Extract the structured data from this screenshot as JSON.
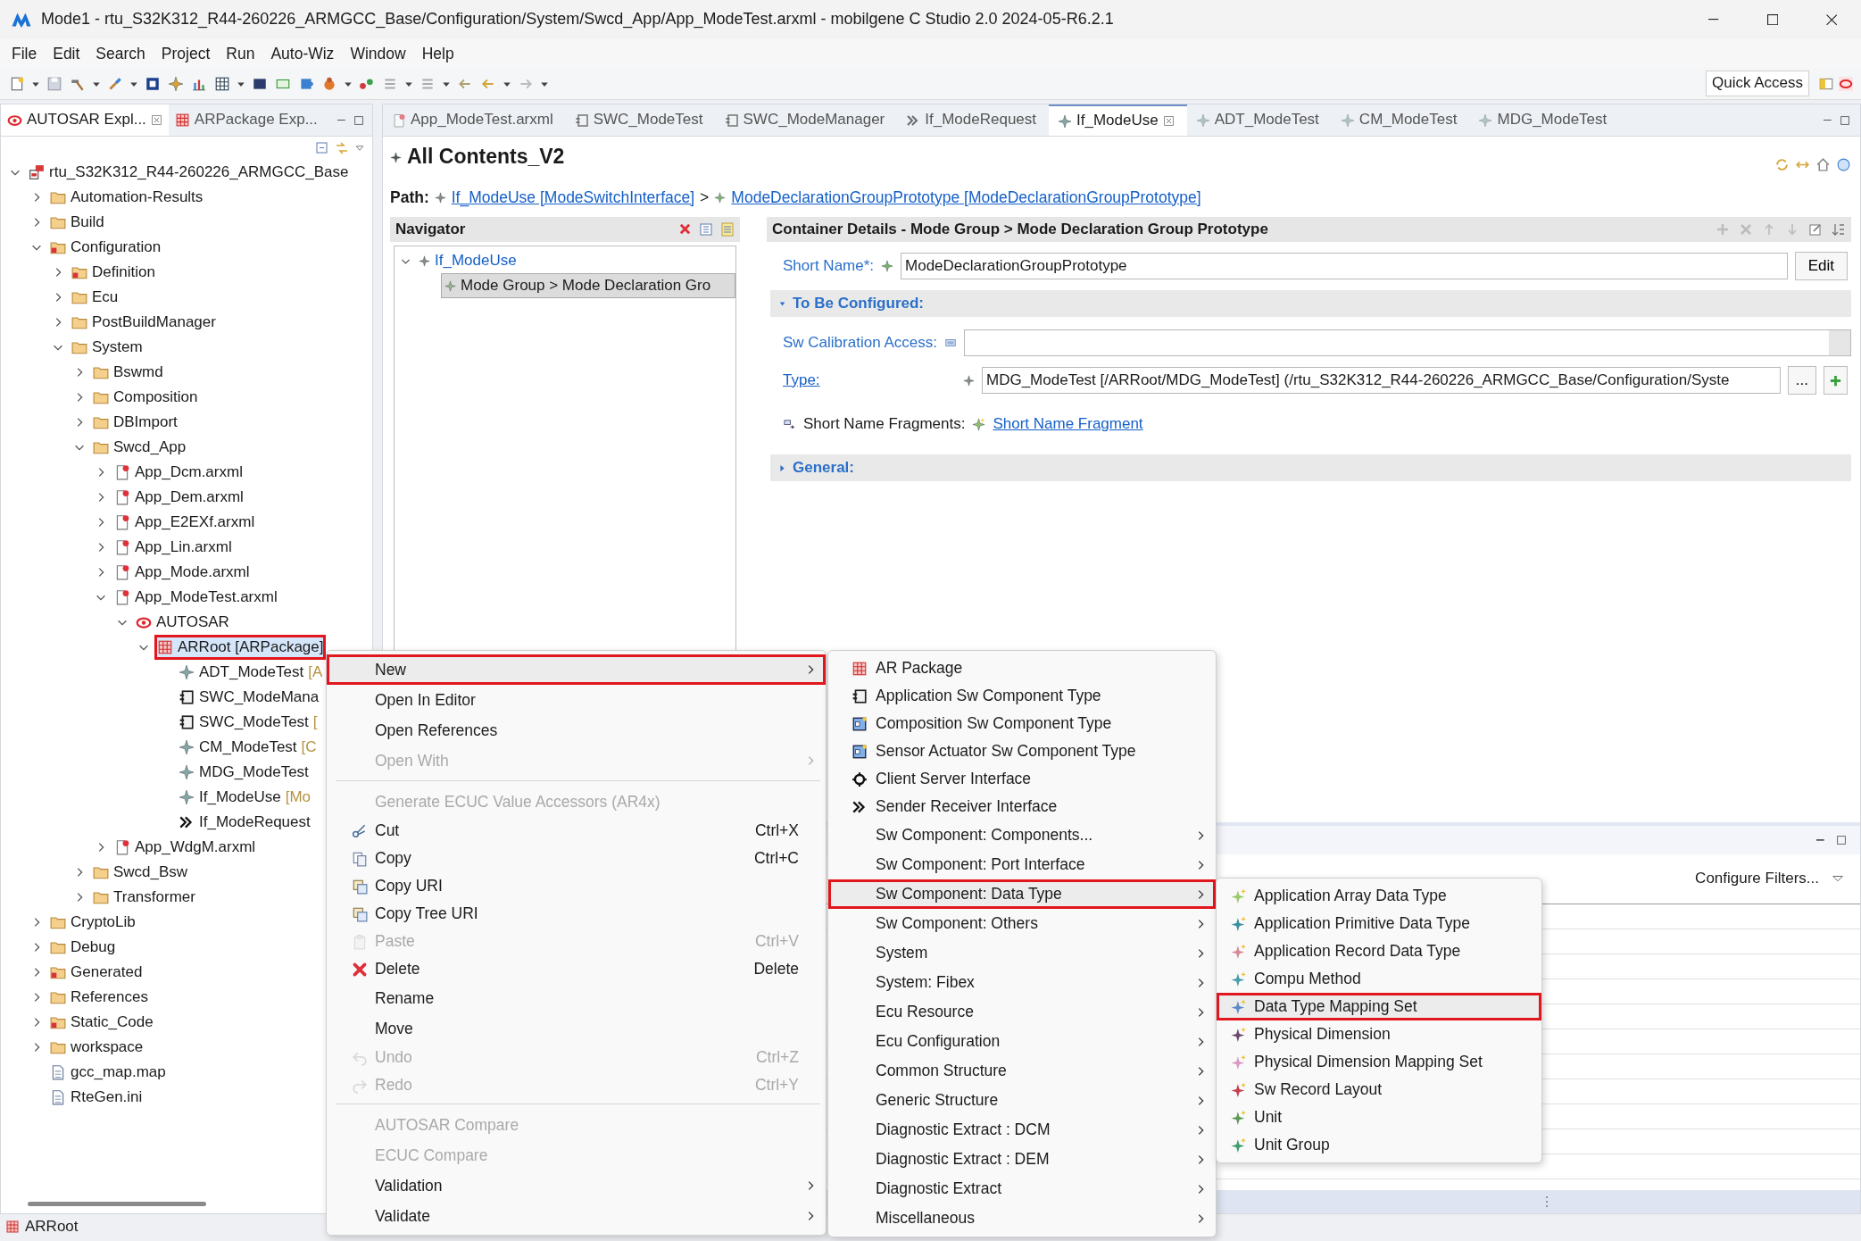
{
  "window": {
    "title": "Mode1 - rtu_S32K312_R44-260226_ARMGCC_Base/Configuration/System/Swcd_App/App_ModeTest.arxml - mobilgene C Studio 2.0 2024-05-R6.2.1"
  },
  "menu_bar": [
    "File",
    "Edit",
    "Search",
    "Project",
    "Run",
    "Auto-Wiz",
    "Window",
    "Help"
  ],
  "quick_access": "Quick Access",
  "explorer": {
    "tabs": [
      {
        "label": "AUTOSAR Expl...",
        "selected": true,
        "kind": "autosar"
      },
      {
        "label": "ARPackage Exp...",
        "selected": false,
        "kind": "package"
      }
    ],
    "tree": [
      {
        "label": "rtu_S32K312_R44-260226_ARMGCC_Base",
        "kind": "project",
        "expanded": true,
        "selected": false,
        "highlighted": false,
        "children": [
          {
            "label": "Automation-Results",
            "kind": "folder",
            "expanded": false,
            "selected": false,
            "highlighted": false
          },
          {
            "label": "Build",
            "kind": "folder",
            "expanded": false,
            "selected": false,
            "highlighted": false
          },
          {
            "label": "Configuration",
            "kind": "folderx",
            "expanded": true,
            "selected": false,
            "highlighted": false,
            "children": [
              {
                "label": "Definition",
                "kind": "folderx",
                "expanded": false,
                "selected": false,
                "highlighted": false
              },
              {
                "label": "Ecu",
                "kind": "folder",
                "expanded": false,
                "selected": false,
                "highlighted": false
              },
              {
                "label": "PostBuildManager",
                "kind": "folder",
                "expanded": false,
                "selected": false,
                "highlighted": false
              },
              {
                "label": "System",
                "kind": "folder",
                "expanded": true,
                "selected": false,
                "highlighted": false,
                "children": [
                  {
                    "label": "Bswmd",
                    "kind": "folder",
                    "expanded": false,
                    "selected": false,
                    "highlighted": false
                  },
                  {
                    "label": "Composition",
                    "kind": "folder",
                    "expanded": false,
                    "selected": false,
                    "highlighted": false
                  },
                  {
                    "label": "DBImport",
                    "kind": "folder",
                    "expanded": false,
                    "selected": false,
                    "highlighted": false
                  },
                  {
                    "label": "Swcd_App",
                    "kind": "folder",
                    "expanded": true,
                    "selected": false,
                    "highlighted": false,
                    "children": [
                      {
                        "label": "App_Dcm.arxml",
                        "kind": "file",
                        "expanded": false,
                        "selected": false,
                        "highlighted": false
                      },
                      {
                        "label": "App_Dem.arxml",
                        "kind": "file",
                        "expanded": false,
                        "selected": false,
                        "highlighted": false
                      },
                      {
                        "label": "App_E2EXf.arxml",
                        "kind": "file",
                        "expanded": false,
                        "selected": false,
                        "highlighted": false
                      },
                      {
                        "label": "App_Lin.arxml",
                        "kind": "file",
                        "expanded": false,
                        "selected": false,
                        "highlighted": false
                      },
                      {
                        "label": "App_Mode.arxml",
                        "kind": "file",
                        "expanded": false,
                        "selected": false,
                        "highlighted": false
                      },
                      {
                        "label": "App_ModeTest.arxml",
                        "kind": "file",
                        "expanded": true,
                        "selected": false,
                        "highlighted": false,
                        "children": [
                          {
                            "label": "AUTOSAR",
                            "kind": "autosar",
                            "expanded": true,
                            "selected": false,
                            "highlighted": false,
                            "children": [
                              {
                                "label": "ARRoot [ARPackage]",
                                "kind": "package",
                                "expanded": true,
                                "selected": true,
                                "highlighted": true,
                                "children": [
                                  {
                                    "label": "ADT_ModeTest",
                                    "suffix": "[A",
                                    "kind": "element",
                                    "selected": false,
                                    "highlighted": false
                                  },
                                  {
                                    "label": "SWC_ModeMana",
                                    "kind": "component",
                                    "selected": false,
                                    "highlighted": false
                                  },
                                  {
                                    "label": "SWC_ModeTest",
                                    "suffix": "[",
                                    "kind": "component",
                                    "selected": false,
                                    "highlighted": false
                                  },
                                  {
                                    "label": "CM_ModeTest",
                                    "suffix": "[C",
                                    "kind": "element",
                                    "selected": false,
                                    "highlighted": false
                                  },
                                  {
                                    "label": "MDG_ModeTest",
                                    "kind": "element",
                                    "selected": false,
                                    "highlighted": false
                                  },
                                  {
                                    "label": "If_ModeUse",
                                    "suffix": "[Mo",
                                    "kind": "element",
                                    "selected": false,
                                    "highlighted": false
                                  },
                                  {
                                    "label": "If_ModeRequest",
                                    "kind": "interface",
                                    "selected": false,
                                    "highlighted": false
                                  }
                                ]
                              }
                            ]
                          }
                        ]
                      },
                      {
                        "label": "App_WdgM.arxml",
                        "kind": "file",
                        "expanded": false,
                        "selected": false,
                        "highlighted": false
                      }
                    ]
                  },
                  {
                    "label": "Swcd_Bsw",
                    "kind": "folder",
                    "expanded": false,
                    "selected": false,
                    "highlighted": false
                  },
                  {
                    "label": "Transformer",
                    "kind": "folder",
                    "expanded": false,
                    "selected": false,
                    "highlighted": false
                  }
                ]
              }
            ]
          },
          {
            "label": "CryptoLib",
            "kind": "folder",
            "expanded": false,
            "selected": false,
            "highlighted": false
          },
          {
            "label": "Debug",
            "kind": "folder",
            "expanded": false,
            "selected": false,
            "highlighted": false
          },
          {
            "label": "Generated",
            "kind": "folderx",
            "expanded": false,
            "selected": false,
            "highlighted": false
          },
          {
            "label": "References",
            "kind": "folder",
            "expanded": false,
            "selected": false,
            "highlighted": false
          },
          {
            "label": "Static_Code",
            "kind": "folderx",
            "expanded": false,
            "selected": false,
            "highlighted": false
          },
          {
            "label": "workspace",
            "kind": "folder",
            "expanded": false,
            "selected": false,
            "highlighted": false
          },
          {
            "label": "gcc_map.map",
            "kind": "plain",
            "selected": false,
            "highlighted": false
          },
          {
            "label": "RteGen.ini",
            "kind": "plain",
            "selected": false,
            "highlighted": false
          }
        ]
      }
    ]
  },
  "editor_tabs": [
    {
      "label": "App_ModeTest.arxml",
      "selected": false,
      "kind": "file"
    },
    {
      "label": "SWC_ModeTest",
      "selected": false,
      "kind": "component"
    },
    {
      "label": "SWC_ModeManager",
      "selected": false,
      "kind": "component"
    },
    {
      "label": "If_ModeRequest",
      "selected": false,
      "kind": "interface"
    },
    {
      "label": "If_ModeUse",
      "selected": true,
      "kind": "element"
    },
    {
      "label": "ADT_ModeTest",
      "selected": false,
      "kind": "element"
    },
    {
      "label": "CM_ModeTest",
      "selected": false,
      "kind": "element"
    },
    {
      "label": "MDG_ModeTest",
      "selected": false,
      "kind": "element"
    }
  ],
  "editor": {
    "title": "All Contents_V2",
    "path_label": "Path:",
    "path": [
      "If_ModeUse [ModeSwitchInterface]",
      "ModeDeclarationGroupPrototype [ModeDeclarationGroupPrototype]"
    ],
    "path_separator": ">"
  },
  "navigator": {
    "title": "Navigator",
    "tree": [
      {
        "label": "If_ModeUse",
        "expanded": true,
        "selected": false,
        "children": [
          {
            "label": "Mode Group > Mode Declaration Gro",
            "selected": true
          }
        ]
      }
    ]
  },
  "details": {
    "title": "Container Details - Mode Group > Mode Declaration Group Prototype",
    "short_name_label": "Short Name*:",
    "short_name": "ModeDeclarationGroupPrototype",
    "edit_button": "Edit",
    "sections": [
      {
        "title": "To Be Configured:",
        "expanded": true,
        "fields": [
          {
            "kind": "combo",
            "label": "Sw Calibration Access:"
          },
          {
            "kind": "reference",
            "label": "Type:",
            "value": "MDG_ModeTest [/ARRoot/MDG_ModeTest] (/rtu_S32K312_R44-260226_ARMGCC_Base/Configuration/Syste",
            "browse_button": "..."
          },
          {
            "kind": "fragments",
            "label": "Short Name Fragments:",
            "link": "Short Name Fragment"
          }
        ]
      },
      {
        "title": "General:",
        "expanded": false
      }
    ]
  },
  "bottom_panel": {
    "filter_button": "Configure Filters..."
  },
  "status_bar": {
    "text": "ARRoot"
  },
  "context_menu": [
    {
      "kind": "text",
      "label": "New",
      "submenu": true,
      "disabled": false,
      "highlighted": true
    },
    {
      "kind": "text",
      "label": "Open In Editor",
      "submenu": false,
      "disabled": false,
      "highlighted": false
    },
    {
      "kind": "text",
      "label": "Open References",
      "submenu": false,
      "disabled": false,
      "highlighted": false
    },
    {
      "kind": "text",
      "label": "Open With",
      "submenu": true,
      "disabled": true,
      "highlighted": false
    },
    {
      "kind": "separator"
    },
    {
      "kind": "text",
      "label": "Generate ECUC Value Accessors (AR4x)",
      "submenu": false,
      "disabled": true,
      "highlighted": false
    },
    {
      "kind": "cut",
      "label": "Cut",
      "shortcut": "Ctrl+X",
      "submenu": false,
      "disabled": false,
      "highlighted": false
    },
    {
      "kind": "copy",
      "label": "Copy",
      "shortcut": "Ctrl+C",
      "submenu": false,
      "disabled": false,
      "highlighted": false
    },
    {
      "kind": "uri",
      "label": "Copy URI",
      "submenu": false,
      "disabled": false,
      "highlighted": false
    },
    {
      "kind": "uri",
      "label": "Copy Tree URI",
      "submenu": false,
      "disabled": false,
      "highlighted": false
    },
    {
      "kind": "paste",
      "label": "Paste",
      "shortcut": "Ctrl+V",
      "submenu": false,
      "disabled": true,
      "highlighted": false
    },
    {
      "kind": "delete",
      "label": "Delete",
      "shortcut": "Delete",
      "submenu": false,
      "disabled": false,
      "highlighted": false
    },
    {
      "kind": "text",
      "label": "Rename",
      "submenu": false,
      "disabled": false,
      "highlighted": false
    },
    {
      "kind": "text",
      "label": "Move",
      "submenu": false,
      "disabled": false,
      "highlighted": false
    },
    {
      "kind": "undo",
      "label": "Undo",
      "shortcut": "Ctrl+Z",
      "submenu": false,
      "disabled": true,
      "highlighted": false
    },
    {
      "kind": "redo",
      "label": "Redo",
      "shortcut": "Ctrl+Y",
      "submenu": false,
      "disabled": true,
      "highlighted": false
    },
    {
      "kind": "separator"
    },
    {
      "kind": "text",
      "label": "AUTOSAR Compare",
      "submenu": false,
      "disabled": true,
      "highlighted": false
    },
    {
      "kind": "text",
      "label": "ECUC Compare",
      "submenu": false,
      "disabled": true,
      "highlighted": false
    },
    {
      "kind": "text",
      "label": "Validation",
      "submenu": true,
      "disabled": false,
      "highlighted": false
    },
    {
      "kind": "text",
      "label": "Validate",
      "submenu": true,
      "disabled": false,
      "highlighted": false
    }
  ],
  "new_submenu": [
    {
      "kind": "package",
      "label": "AR Package",
      "submenu": false,
      "disabled": false,
      "highlighted": false
    },
    {
      "kind": "component",
      "label": "Application Sw Component Type",
      "submenu": false,
      "disabled": false,
      "highlighted": false
    },
    {
      "kind": "composition",
      "label": "Composition Sw Component Type",
      "submenu": false,
      "disabled": false,
      "highlighted": false
    },
    {
      "kind": "composition",
      "label": "Sensor Actuator Sw Component Type",
      "submenu": false,
      "disabled": false,
      "highlighted": false
    },
    {
      "kind": "client-server",
      "label": "Client Server Interface",
      "submenu": false,
      "disabled": false,
      "highlighted": false
    },
    {
      "kind": "interface",
      "label": "Sender Receiver Interface",
      "submenu": false,
      "disabled": false,
      "highlighted": false
    },
    {
      "kind": "text",
      "label": "Sw Component: Components...",
      "submenu": true,
      "disabled": false,
      "highlighted": false
    },
    {
      "kind": "text",
      "label": "Sw Component: Port Interface",
      "submenu": true,
      "disabled": false,
      "highlighted": false
    },
    {
      "kind": "text",
      "label": "Sw Component: Data Type",
      "submenu": true,
      "disabled": false,
      "highlighted": true
    },
    {
      "kind": "text",
      "label": "Sw Component: Others",
      "submenu": true,
      "disabled": false,
      "highlighted": false
    },
    {
      "kind": "text",
      "label": "System",
      "submenu": true,
      "disabled": false,
      "highlighted": false
    },
    {
      "kind": "text",
      "label": "System: Fibex",
      "submenu": true,
      "disabled": false,
      "highlighted": false
    },
    {
      "kind": "text",
      "label": "Ecu Resource",
      "submenu": true,
      "disabled": false,
      "highlighted": false
    },
    {
      "kind": "text",
      "label": "Ecu Configuration",
      "submenu": true,
      "disabled": false,
      "highlighted": false
    },
    {
      "kind": "text",
      "label": "Common Structure",
      "submenu": true,
      "disabled": false,
      "highlighted": false
    },
    {
      "kind": "text",
      "label": "Generic Structure",
      "submenu": true,
      "disabled": false,
      "highlighted": false
    },
    {
      "kind": "text",
      "label": "Diagnostic Extract : DCM",
      "submenu": true,
      "disabled": false,
      "highlighted": false
    },
    {
      "kind": "text",
      "label": "Diagnostic Extract : DEM",
      "submenu": true,
      "disabled": false,
      "highlighted": false
    },
    {
      "kind": "text",
      "label": "Diagnostic Extract",
      "submenu": true,
      "disabled": false,
      "highlighted": false
    },
    {
      "kind": "text",
      "label": "Miscellaneous",
      "submenu": true,
      "disabled": false,
      "highlighted": false
    }
  ],
  "data_type_submenu": [
    {
      "kind": "sparkle",
      "label": "Application Array Data Type",
      "color": "#9cc96a",
      "submenu": false,
      "disabled": false,
      "highlighted": false
    },
    {
      "kind": "sparkle",
      "label": "Application Primitive Data Type",
      "color": "#3b8f9e",
      "submenu": false,
      "disabled": false,
      "highlighted": false
    },
    {
      "kind": "sparkle",
      "label": "Application Record Data Type",
      "color": "#d68a96",
      "submenu": false,
      "disabled": false,
      "highlighted": false
    },
    {
      "kind": "sparkle",
      "label": "Compu Method",
      "color": "#4a9cae",
      "submenu": false,
      "disabled": false,
      "highlighted": false
    },
    {
      "kind": "sparkle",
      "label": "Data Type Mapping Set",
      "color": "#5b8bc9",
      "submenu": false,
      "disabled": false,
      "highlighted": true
    },
    {
      "kind": "sparkle",
      "label": "Physical Dimension",
      "color": "#6b4a6b",
      "submenu": false,
      "disabled": false,
      "highlighted": false
    },
    {
      "kind": "sparkle",
      "label": "Physical Dimension Mapping Set",
      "color": "#d99ac4",
      "submenu": false,
      "disabled": false,
      "highlighted": false
    },
    {
      "kind": "sparkle",
      "label": "Sw Record Layout",
      "color": "#c4404f",
      "submenu": false,
      "disabled": false,
      "highlighted": false
    },
    {
      "kind": "sparkle",
      "label": "Unit",
      "color": "#5e9a5a",
      "submenu": false,
      "disabled": false,
      "highlighted": false
    },
    {
      "kind": "sparkle",
      "label": "Unit Group",
      "color": "#3f9f6c",
      "submenu": false,
      "disabled": false,
      "highlighted": false
    }
  ]
}
